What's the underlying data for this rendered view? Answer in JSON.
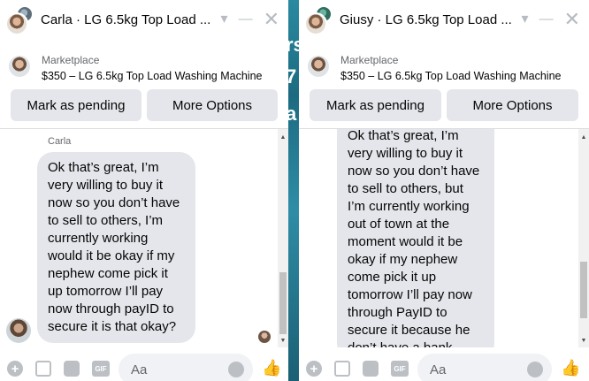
{
  "background": {
    "letters": [
      "rs",
      "7",
      "a"
    ]
  },
  "chats": {
    "left": {
      "title": "Carla · LG 6.5kg Top Load ...",
      "marketplace_label": "Marketplace",
      "listing_title": "$350 – LG 6.5kg Top Load Washing Machine",
      "mark_pending_label": "Mark as pending",
      "more_options_label": "More Options",
      "sender_name": "Carla",
      "message": "Ok that’s great, I’m\nvery willing to buy it\nnow so you don’t have\nto sell to others, I’m\ncurrently working\nwould it be okay if my\nnephew come pick it\nup tomorrow I’ll pay\nnow through payID to\nsecure it is that okay?",
      "composer_placeholder": "Aa",
      "gif_label": "GIF"
    },
    "right": {
      "title": "Giusy · LG 6.5kg Top Load ...",
      "marketplace_label": "Marketplace",
      "listing_title": "$350 – LG 6.5kg Top Load Washing Machine",
      "mark_pending_label": "Mark as pending",
      "more_options_label": "More Options",
      "message": "Ok that’s great, I’m\nvery willing to buy it\nnow so you don’t have\nto sell to others, but\nI’m currently working\nout of town at the\nmoment would it be\nokay if my nephew\ncome pick it up\ntomorrow I’ll pay now\nthrough PayID to\nsecure it because he\ndon’t have a bank",
      "composer_placeholder": "Aa",
      "gif_label": "GIF"
    }
  },
  "icons": {
    "chevron": "▾",
    "minimize": "—",
    "close": "✕",
    "plus": "+",
    "like": "👍",
    "scroll_up": "▲",
    "scroll_down": "▼"
  },
  "colors": {
    "bubble": "#e4e6eb",
    "button": "#e4e6eb",
    "icon_gray": "#bcc0c4",
    "background": "#1e7085"
  }
}
